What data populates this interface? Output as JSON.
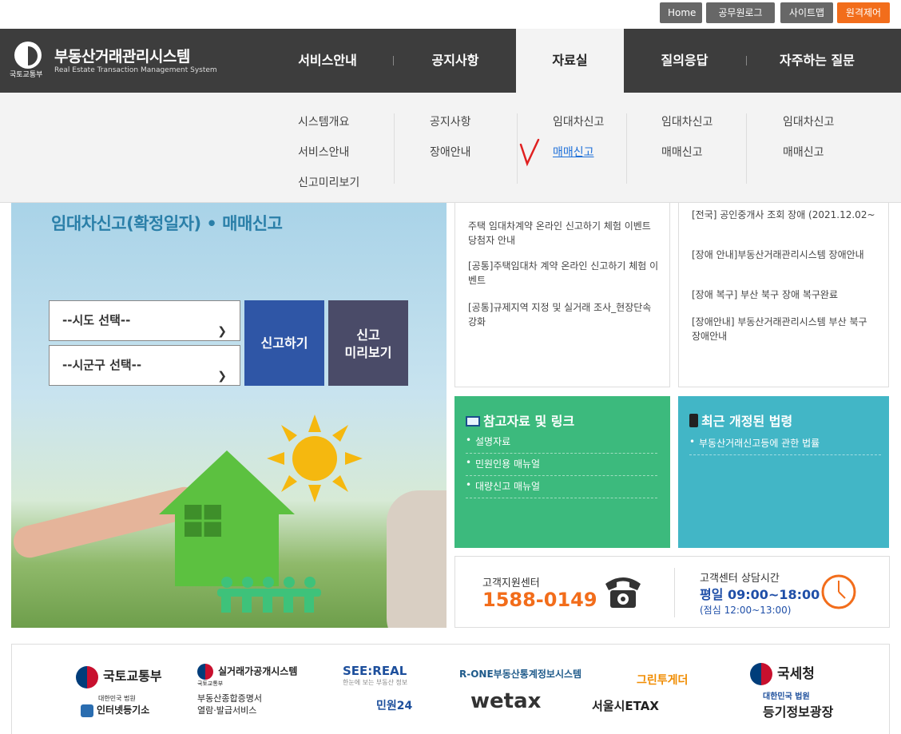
{
  "top_utility": {
    "home": "Home",
    "official_login": "공무원로그인",
    "sitemap": "사이트맵",
    "remote_control": "원격제어"
  },
  "logo": {
    "ministry": "국토교통부",
    "title": "부동산거래관리시스템",
    "subtitle": "Real Estate Transaction Management System"
  },
  "nav": [
    {
      "label": "서비스안내"
    },
    {
      "label": "공지사항"
    },
    {
      "label": "자료실"
    },
    {
      "label": "질의응답"
    },
    {
      "label": "자주하는 질문"
    }
  ],
  "dropdown": {
    "col1": [
      "시스템개요",
      "서비스안내",
      "신고미리보기"
    ],
    "col2": [
      "공지사항",
      "장애안내"
    ],
    "col3": [
      "임대차신고",
      "매매신고"
    ],
    "col4": [
      "임대차신고",
      "매매신고"
    ],
    "col5": [
      "임대차신고",
      "매매신고"
    ]
  },
  "hero": {
    "title": "임대차신고(확정일자) • 매매신고",
    "sido_select": "--시도 선택--",
    "sigungu_select": "--시군구 선택--",
    "report_button": "신고하기",
    "preview_button_line1": "신고",
    "preview_button_line2": "미리보기"
  },
  "notice_left": [
    "주택 임대차계약 온라인 신고하기 체험 이벤트 당첨자 안내",
    "[공통]주택임대차 계약 온라인 신고하기 체험 이벤트",
    "[공통]규제지역 지정 및 실거래 조사_현장단속 강화"
  ],
  "notice_right": [
    "[전국] 공인중개사 조회 장애 (2021.12.02~",
    "[장애 안내]부동산거래관리시스템 장애안내",
    "[장애 복구] 부산 북구 장애 복구완료",
    "[장애안내] 부동산거래관리시스템 부산 북구 장애안내"
  ],
  "reference": {
    "title": "참고자료 및 링크",
    "links": [
      "설명자료",
      "민원인용 매뉴얼",
      "대량신고 매뉴얼"
    ]
  },
  "law": {
    "title": "최근 개정된 법령",
    "links": [
      "부동산거래신고등에 관한 법률"
    ]
  },
  "customer": {
    "label": "고객지원센터",
    "phone": "1588-0149",
    "hours_label": "고객센터 상담시간",
    "hours": "평일 09:00~18:00",
    "lunch": "(점심 12:00~13:00)"
  },
  "partners": {
    "molit": "국토교통부",
    "court_internet": "인터넷등기소",
    "court_small": "대한민국 법원",
    "rtms": "실거래가공개시스템",
    "rtms_small": "국토교통부",
    "certificate_line1": "부동산종합증명서",
    "certificate_line2": "열람·발급서비스",
    "seereal": "SEE:REAL",
    "seereal_sub": "한눈에 보는 부동산 정보",
    "minwon24": "민원24",
    "rone": "R-ONE부동산통계정보시스템",
    "wetax": "wetax",
    "greentogether": "그린투게더",
    "etax": "서울시ETAX",
    "nts": "국세청",
    "registry": "등기정보광장",
    "registry_small": "대한민국 법원"
  },
  "colors": {
    "nav_bg": "#3d3d3d",
    "report_btn": "#2f56a6",
    "preview_btn": "#4a4b68",
    "reference_bg": "#3cba7d",
    "law_bg": "#42b6c6",
    "phone": "#f26d1b",
    "link": "#1d6fd8"
  }
}
